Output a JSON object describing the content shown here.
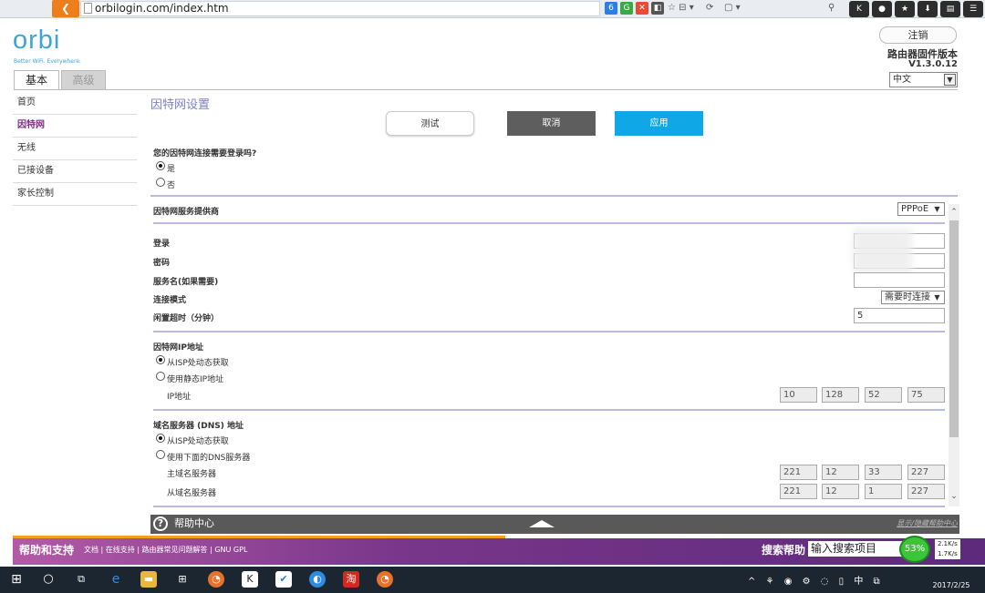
{
  "browser": {
    "url": "orbilogin.com/index.htm",
    "back_icon": "back-arrow-icon"
  },
  "brand": {
    "logo": "orbi",
    "tagline": "Better WiFi. Everywhere."
  },
  "tabs": [
    {
      "label": "基本",
      "active": true
    },
    {
      "label": "高级",
      "active": false
    }
  ],
  "header": {
    "logout": "注销",
    "firmware_label": "路由器固件版本",
    "firmware_version": "V1.3.0.12",
    "language": "中文"
  },
  "sidebar": {
    "items": [
      {
        "label": "首页"
      },
      {
        "label": "因特网"
      },
      {
        "label": "无线"
      },
      {
        "label": "已接设备"
      },
      {
        "label": "家长控制"
      }
    ]
  },
  "main": {
    "title": "因特网设置",
    "buttons": {
      "test": "测试",
      "cancel": "取消",
      "apply": "应用"
    },
    "login_question": "您的因特网连接需要登录吗?",
    "login_yes": "是",
    "login_no": "否",
    "isp_label": "因特网服务提供商",
    "isp_value": "PPPoE",
    "fields": {
      "login": "登录",
      "password": "密码",
      "service_name": "服务名(如果需要)",
      "connection_mode": "连接模式",
      "connection_mode_value": "需要时连接",
      "idle_timeout": "闲置超时（分钟）",
      "idle_timeout_value": "5"
    },
    "ip_section": {
      "title": "因特网IP地址",
      "option_dynamic": "从ISP处动态获取",
      "option_static": "使用静态IP地址",
      "ip_label": "IP地址",
      "ip": [
        "10",
        "128",
        "52",
        "75"
      ]
    },
    "dns_section": {
      "title": "域名服务器 (DNS) 地址",
      "option_dynamic": "从ISP处动态获取",
      "option_manual": "使用下面的DNS服务器",
      "primary_label": "主域名服务器",
      "secondary_label": "从域名服务器",
      "primary": [
        "221",
        "12",
        "33",
        "227"
      ],
      "secondary": [
        "221",
        "12",
        "1",
        "227"
      ]
    }
  },
  "help": {
    "title": "帮助中心",
    "toggle": "显示/隐藏帮助中心"
  },
  "footer": {
    "support": "帮助和支持",
    "links": "文档 | 在线支持 | 路由器常见问题解答 | GNU GPL",
    "search_label": "搜索帮助",
    "search_placeholder": "输入搜索项目"
  },
  "overlay": {
    "meter": "53%",
    "up": "2.1K/s",
    "down": "1.7K/s"
  },
  "taskbar": {
    "date": "2017/2/25"
  }
}
